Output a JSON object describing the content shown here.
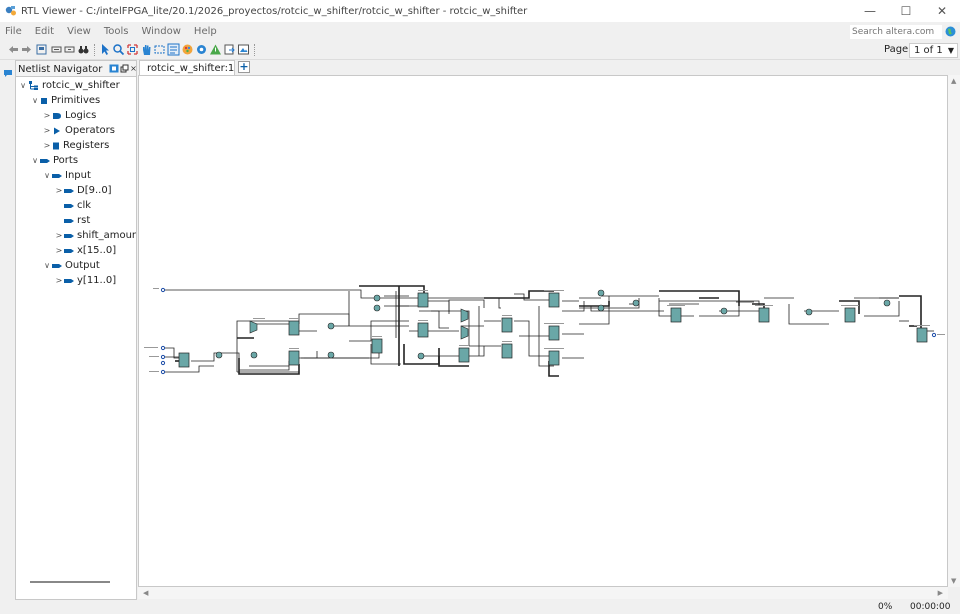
{
  "window": {
    "title": "RTL Viewer - C:/intelFPGA_lite/20.1/2026_proyectos/rotcic_w_shifter/rotcic_w_shifter - rotcic_w_shifter",
    "controls": {
      "minimize": "—",
      "maximize": "☐",
      "close": "✕"
    }
  },
  "menu": {
    "items": [
      {
        "label": "File"
      },
      {
        "label": "Edit"
      },
      {
        "label": "View"
      },
      {
        "label": "Tools"
      },
      {
        "label": "Window"
      },
      {
        "label": "Help"
      }
    ]
  },
  "search": {
    "placeholder": "Search altera.com"
  },
  "toolbar": {
    "page_label": "Page:",
    "page_value": "1 of 1"
  },
  "navigator": {
    "title": "Netlist Navigator",
    "tree": [
      {
        "label": "rotcic_w_shifter",
        "expander": "∨",
        "icon": "hierarchy-icon"
      },
      {
        "label": "Primitives",
        "expander": "∨",
        "icon": "primitives-icon"
      },
      {
        "label": "Logics",
        "expander": ">",
        "icon": "logic-gate-icon"
      },
      {
        "label": "Operators",
        "expander": ">",
        "icon": "operator-icon"
      },
      {
        "label": "Registers",
        "expander": ">",
        "icon": "register-icon"
      },
      {
        "label": "Ports",
        "expander": "∨",
        "icon": "port-icon"
      },
      {
        "label": "Input",
        "expander": "∨",
        "icon": "port-icon"
      },
      {
        "label": "D[9..0]",
        "expander": ">",
        "icon": "port-icon"
      },
      {
        "label": "clk",
        "expander": "",
        "icon": "port-icon"
      },
      {
        "label": "rst",
        "expander": "",
        "icon": "port-icon"
      },
      {
        "label": "shift_amount",
        "expander": ">",
        "icon": "port-icon"
      },
      {
        "label": "x[15..0]",
        "expander": ">",
        "icon": "port-icon"
      },
      {
        "label": "Output",
        "expander": "∨",
        "icon": "port-icon"
      },
      {
        "label": "y[11..0]",
        "expander": ">",
        "icon": "port-icon"
      }
    ]
  },
  "tabs": [
    {
      "label": "rotcic_w_shifter:1"
    }
  ],
  "add_tab_label": "+",
  "status": {
    "progress": "0%",
    "elapsed": "00:00:00"
  },
  "colors": {
    "accent": "#0a5fa8",
    "register_fill": "#6aa7a7",
    "wire": "#222222"
  }
}
